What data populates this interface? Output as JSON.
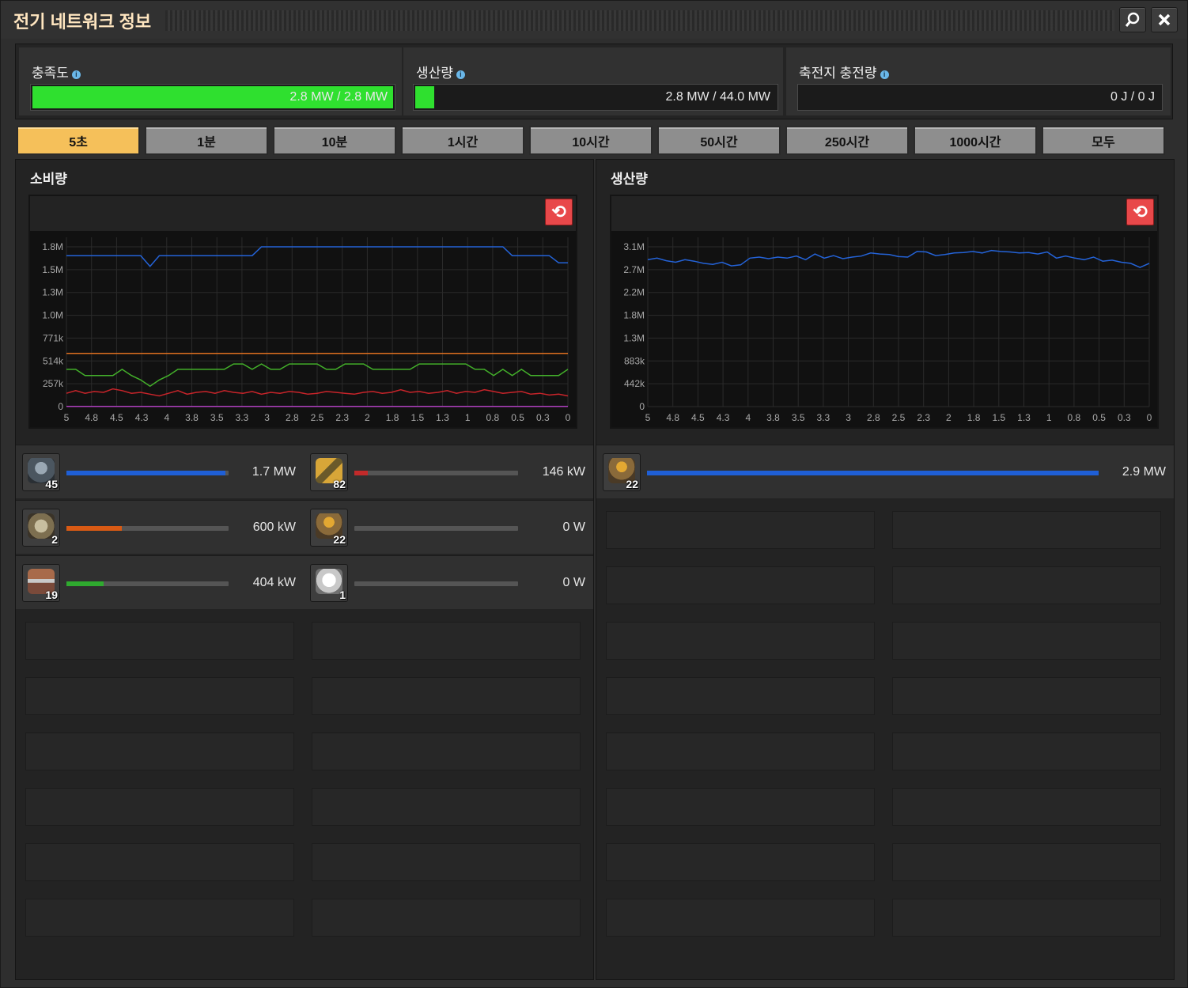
{
  "window": {
    "title": "전기 네트워크 정보",
    "search_icon": "search-icon",
    "close_icon": "close-icon"
  },
  "stats": [
    {
      "label": "충족도",
      "value": "2.8 MW / 2.8 MW",
      "fill": 1.0,
      "color": "#2fe02f"
    },
    {
      "label": "생산량",
      "value": "2.8 MW / 44.0 MW",
      "fill": 0.06,
      "color": "#2fe02f"
    },
    {
      "label": "축전지 충전량",
      "value": "0 J / 0 J",
      "fill": 0,
      "color": "#2fe02f"
    }
  ],
  "tabs": [
    "5초",
    "1분",
    "10분",
    "1시간",
    "10시간",
    "50시간",
    "250시간",
    "1000시간",
    "모두"
  ],
  "active_tab": 0,
  "consumption": {
    "title": "소비량",
    "reset_icon": "reset-icon",
    "chart_data": {
      "type": "line",
      "xlabel": "",
      "ylabel": "",
      "x_ticks": [
        "5",
        "4.8",
        "4.5",
        "4.3",
        "4",
        "3.8",
        "3.5",
        "3.3",
        "3",
        "2.8",
        "2.5",
        "2.3",
        "2",
        "1.8",
        "1.5",
        "1.3",
        "1",
        "0.8",
        "0.5",
        "0.3",
        "0"
      ],
      "y_ticks": [
        "0",
        "257k",
        "514k",
        "771k",
        "1.0M",
        "1.3M",
        "1.5M",
        "1.8M"
      ],
      "ylim": [
        0,
        1800000
      ],
      "xlim": [
        5,
        0
      ],
      "grid": true,
      "series": [
        {
          "color": "#2463d8",
          "values": [
            1700000,
            1700000,
            1700000,
            1700000,
            1700000,
            1700000,
            1700000,
            1700000,
            1700000,
            1580000,
            1700000,
            1700000,
            1700000,
            1700000,
            1700000,
            1700000,
            1700000,
            1700000,
            1700000,
            1700000,
            1700000,
            1800000,
            1800000,
            1800000,
            1800000,
            1800000,
            1800000,
            1800000,
            1800000,
            1800000,
            1800000,
            1800000,
            1800000,
            1800000,
            1800000,
            1800000,
            1800000,
            1800000,
            1800000,
            1800000,
            1800000,
            1800000,
            1800000,
            1800000,
            1800000,
            1800000,
            1800000,
            1800000,
            1700000,
            1700000,
            1700000,
            1700000,
            1700000,
            1620000,
            1620000
          ]
        },
        {
          "color": "#e07020",
          "values": [
            600000,
            600000,
            600000,
            600000,
            600000,
            600000,
            600000,
            600000,
            600000,
            600000,
            600000,
            600000,
            600000,
            600000,
            600000,
            600000,
            600000,
            600000,
            600000,
            600000,
            600000,
            600000,
            600000,
            600000,
            600000,
            600000,
            600000,
            600000,
            600000,
            600000,
            600000,
            600000,
            600000,
            600000,
            600000,
            600000,
            600000,
            600000,
            600000,
            600000,
            600000,
            600000,
            600000,
            600000,
            600000,
            600000,
            600000,
            600000,
            600000,
            600000,
            600000,
            600000,
            600000,
            600000,
            600000
          ]
        },
        {
          "color": "#43b02a",
          "values": [
            420000,
            420000,
            350000,
            350000,
            350000,
            350000,
            420000,
            350000,
            300000,
            230000,
            300000,
            350000,
            420000,
            420000,
            420000,
            420000,
            420000,
            420000,
            480000,
            480000,
            420000,
            480000,
            420000,
            420000,
            480000,
            480000,
            480000,
            480000,
            420000,
            420000,
            480000,
            480000,
            480000,
            420000,
            420000,
            420000,
            420000,
            420000,
            480000,
            480000,
            480000,
            480000,
            480000,
            480000,
            420000,
            420000,
            350000,
            420000,
            350000,
            420000,
            350000,
            350000,
            350000,
            350000,
            420000
          ]
        },
        {
          "color": "#c8242a",
          "values": [
            150000,
            180000,
            150000,
            170000,
            160000,
            200000,
            180000,
            150000,
            160000,
            140000,
            120000,
            150000,
            180000,
            140000,
            160000,
            170000,
            150000,
            180000,
            160000,
            150000,
            170000,
            140000,
            160000,
            150000,
            170000,
            160000,
            140000,
            150000,
            170000,
            160000,
            150000,
            140000,
            160000,
            170000,
            150000,
            160000,
            190000,
            160000,
            170000,
            150000,
            160000,
            180000,
            150000,
            170000,
            160000,
            190000,
            170000,
            150000,
            160000,
            170000,
            140000,
            150000,
            130000,
            140000,
            120000
          ]
        },
        {
          "color": "#b040c0",
          "values": [
            3000,
            3000,
            3000,
            3000,
            3000,
            3000,
            3000,
            3000,
            3000,
            3000,
            3000,
            3000,
            3000,
            3000,
            3000,
            3000,
            3000,
            3000,
            3000,
            3000,
            3000,
            3000,
            3000,
            3000,
            3000,
            3000,
            3000,
            3000,
            3000,
            3000,
            3000,
            3000,
            3000,
            3000,
            3000,
            3000,
            3000,
            3000,
            3000,
            3000,
            3000,
            3000,
            3000,
            3000,
            3000,
            3000,
            3000,
            3000,
            3000,
            3000,
            3000,
            3000,
            3000,
            3000,
            3000
          ]
        }
      ]
    },
    "rows": [
      {
        "icon": "rocket-silo-icon",
        "count": "45",
        "value": "1.7 MW",
        "fill": 0.98,
        "color": "#1f5fd6"
      },
      {
        "icon": "inserter-icon",
        "count": "82",
        "value": "146 kW",
        "fill": 0.08,
        "color": "#c22a2a"
      },
      {
        "icon": "mining-drill-icon",
        "count": "2",
        "value": "600 kW",
        "fill": 0.34,
        "color": "#d85a14"
      },
      {
        "icon": "steam-engine-icon",
        "count": "22",
        "value": "0 W",
        "fill": 0,
        "color": "#c22a2a"
      },
      {
        "icon": "assembler-icon",
        "count": "19",
        "value": "404 kW",
        "fill": 0.23,
        "color": "#2faa2f"
      },
      {
        "icon": "lamp-icon",
        "count": "1",
        "value": "0 W",
        "fill": 0,
        "color": "#c22a2a"
      }
    ]
  },
  "production": {
    "title": "생산량",
    "reset_icon": "reset-icon",
    "chart_data": {
      "type": "line",
      "xlabel": "",
      "ylabel": "",
      "x_ticks": [
        "5",
        "4.8",
        "4.5",
        "4.3",
        "4",
        "3.8",
        "3.5",
        "3.3",
        "3",
        "2.8",
        "2.5",
        "2.3",
        "2",
        "1.8",
        "1.5",
        "1.3",
        "1",
        "0.8",
        "0.5",
        "0.3",
        "0"
      ],
      "y_ticks": [
        "0",
        "442k",
        "883k",
        "1.3M",
        "1.8M",
        "2.2M",
        "2.7M",
        "3.1M"
      ],
      "ylim": [
        0,
        3100000
      ],
      "xlim": [
        5,
        0
      ],
      "grid": true,
      "series": [
        {
          "color": "#2463d8",
          "values": [
            2850000,
            2880000,
            2830000,
            2800000,
            2850000,
            2820000,
            2780000,
            2760000,
            2800000,
            2730000,
            2750000,
            2880000,
            2900000,
            2870000,
            2900000,
            2880000,
            2920000,
            2850000,
            2960000,
            2880000,
            2930000,
            2870000,
            2900000,
            2920000,
            2980000,
            2960000,
            2950000,
            2910000,
            2900000,
            3010000,
            3000000,
            2930000,
            2950000,
            2980000,
            2990000,
            3010000,
            2980000,
            3030000,
            3010000,
            3000000,
            2980000,
            2990000,
            2960000,
            3000000,
            2880000,
            2920000,
            2880000,
            2850000,
            2900000,
            2820000,
            2840000,
            2800000,
            2780000,
            2700000,
            2780000
          ]
        }
      ]
    },
    "rows": [
      {
        "icon": "steam-engine-icon",
        "count": "22",
        "value": "2.9 MW",
        "fill": 1.0,
        "color": "#1f5fd6"
      }
    ]
  }
}
